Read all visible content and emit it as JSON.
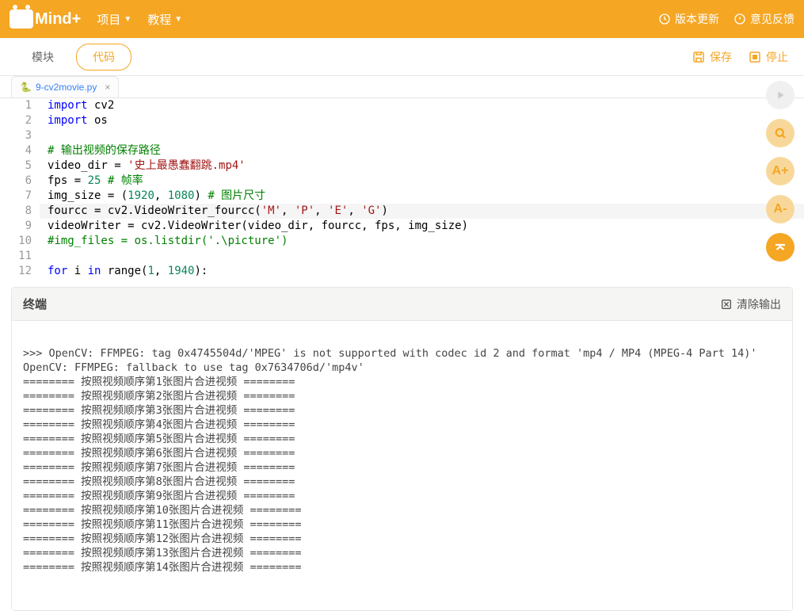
{
  "header": {
    "logo_text": "Mind+",
    "menu": [
      {
        "label": "项目"
      },
      {
        "label": "教程"
      }
    ],
    "links": {
      "version_update": "版本更新",
      "feedback": "意见反馈"
    }
  },
  "toolbar": {
    "tabs": {
      "blocks": "模块",
      "code": "代码"
    },
    "save": "保存",
    "stop": "停止"
  },
  "file_tab": {
    "name": "9-cv2movie.py"
  },
  "code_tokens": [
    [
      {
        "t": "import",
        "c": "kw"
      },
      {
        "t": " cv2"
      }
    ],
    [
      {
        "t": "import",
        "c": "kw"
      },
      {
        "t": " os"
      }
    ],
    [],
    [
      {
        "t": "# 输出视频的保存路径",
        "c": "cm"
      }
    ],
    [
      {
        "t": "video_dir = "
      },
      {
        "t": "'史上最愚蠢翻跳.mp4'",
        "c": "st"
      }
    ],
    [
      {
        "t": "fps = "
      },
      {
        "t": "25",
        "c": "nm"
      },
      {
        "t": " "
      },
      {
        "t": "# 帧率",
        "c": "cm"
      }
    ],
    [
      {
        "t": "img_size = ("
      },
      {
        "t": "1920",
        "c": "nm"
      },
      {
        "t": ", "
      },
      {
        "t": "1080",
        "c": "nm"
      },
      {
        "t": ") "
      },
      {
        "t": "# 图片尺寸",
        "c": "cm"
      }
    ],
    [
      {
        "t": "fourcc = cv2.VideoWriter_fourcc("
      },
      {
        "t": "'M'",
        "c": "st"
      },
      {
        "t": ", "
      },
      {
        "t": "'P'",
        "c": "st"
      },
      {
        "t": ", "
      },
      {
        "t": "'E'",
        "c": "st"
      },
      {
        "t": ", "
      },
      {
        "t": "'G'",
        "c": "st"
      },
      {
        "t": ")"
      }
    ],
    [
      {
        "t": "videoWriter = cv2.VideoWriter(video_dir, fourcc, fps, img_size)"
      }
    ],
    [
      {
        "t": "#img_files = os.listdir('.\\picture')",
        "c": "cm"
      }
    ],
    [],
    [
      {
        "t": "for",
        "c": "kw"
      },
      {
        "t": " i "
      },
      {
        "t": "in",
        "c": "kw"
      },
      {
        "t": " range("
      },
      {
        "t": "1",
        "c": "nm"
      },
      {
        "t": ", "
      },
      {
        "t": "1940",
        "c": "nm"
      },
      {
        "t": "):"
      }
    ]
  ],
  "terminal": {
    "title": "终端",
    "clear": "清除输出",
    "lines": [
      "",
      ">>> OpenCV: FFMPEG: tag 0x4745504d/'MPEG' is not supported with codec id 2 and format 'mp4 / MP4 (MPEG-4 Part 14)'",
      "OpenCV: FFMPEG: fallback to use tag 0x7634706d/'mp4v'",
      "======== 按照视频顺序第1张图片合进视频 ========",
      "======== 按照视频顺序第2张图片合进视频 ========",
      "======== 按照视频顺序第3张图片合进视频 ========",
      "======== 按照视频顺序第4张图片合进视频 ========",
      "======== 按照视频顺序第5张图片合进视频 ========",
      "======== 按照视频顺序第6张图片合进视频 ========",
      "======== 按照视频顺序第7张图片合进视频 ========",
      "======== 按照视频顺序第8张图片合进视频 ========",
      "======== 按照视频顺序第9张图片合进视频 ========",
      "======== 按照视频顺序第10张图片合进视频 ========",
      "======== 按照视频顺序第11张图片合进视频 ========",
      "======== 按照视频顺序第12张图片合进视频 ========",
      "======== 按照视频顺序第13张图片合进视频 ========",
      "======== 按照视频顺序第14张图片合进视频 ========"
    ]
  },
  "side_labels": {
    "font_plus": "A+",
    "font_minus": "A-"
  }
}
